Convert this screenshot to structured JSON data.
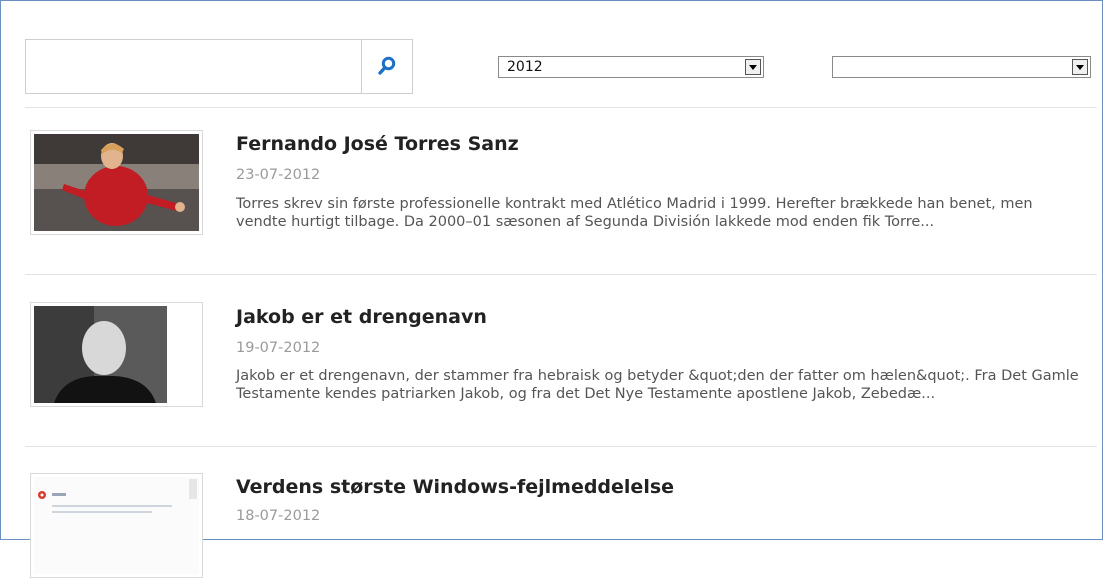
{
  "search": {
    "value": "",
    "placeholder": "",
    "icon": "search-icon",
    "icon_color": "#1e6fc8"
  },
  "filters": {
    "year": {
      "selected": "2012"
    },
    "category": {
      "selected": ""
    }
  },
  "articles": [
    {
      "title": "Fernando José Torres Sanz",
      "date": "23-07-2012",
      "description": "Torres skrev sin første professionelle kontrakt med Atlético Madrid i 1999. Herefter brækkede han benet, men vendte hurtigt tilbage. Da 2000–01 sæsonen af Segunda División lakkede mod enden fik Torre..."
    },
    {
      "title": "Jakob er et drengenavn",
      "date": "19-07-2012",
      "description": "Jakob er et drengenavn, der stammer fra hebraisk og betyder &quot;den der fatter om hælen&quot;. Fra Det Gamle Testamente kendes patriarken Jakob, og fra det Det Nye Testamente apostlene Jakob, Zebedæ..."
    },
    {
      "title": "Verdens største Windows-fejlmeddelelse",
      "date": "18-07-2012",
      "description": ""
    }
  ]
}
